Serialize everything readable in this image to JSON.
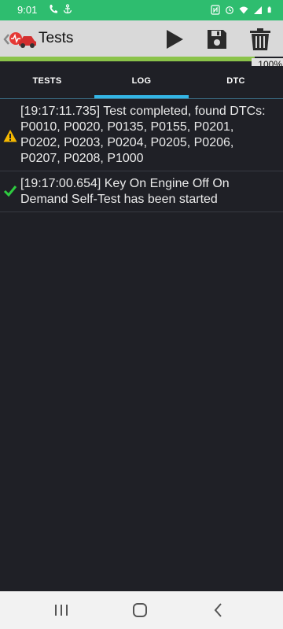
{
  "status_bar": {
    "time": "9:01"
  },
  "toolbar": {
    "title": "Tests"
  },
  "progress": {
    "value": 1.0,
    "label": "100%"
  },
  "tabs": [
    {
      "label": "TESTS",
      "active": false
    },
    {
      "label": "LOG",
      "active": true
    },
    {
      "label": "DTC",
      "active": false
    }
  ],
  "log": [
    {
      "status": "warning",
      "icon": "warning-triangle-icon",
      "text": "[19:17:11.735] Test completed, found DTCs: P0010, P0020, P0135, P0155, P0201, P0202, P0203, P0204, P0205, P0206, P0207, P0208, P1000"
    },
    {
      "status": "success",
      "icon": "checkmark-icon",
      "text": "[19:17:00.654] Key On Engine Off On Demand Self-Test has been started"
    }
  ],
  "colors": {
    "status_bar": "#2ebd6f",
    "toolbar": "#d9d9d9",
    "background": "#1f2026",
    "tab_indicator": "#33b5e5",
    "progress_fill": "#8bc34a",
    "warning": "#f5b800",
    "success": "#2ecc40"
  }
}
